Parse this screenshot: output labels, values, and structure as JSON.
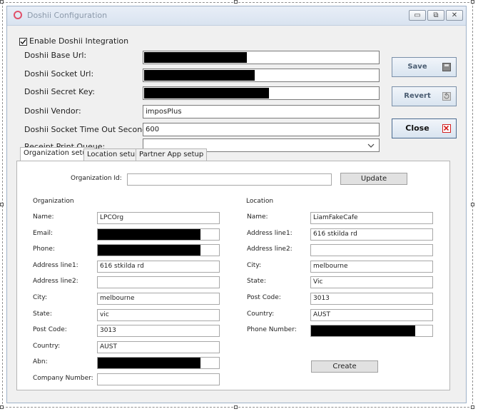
{
  "window": {
    "title": "Doshii Configuration",
    "min_glyph": "▭",
    "max_glyph": "⧉",
    "close_glyph": "✕"
  },
  "enable": {
    "label": "Enable Doshii Integration",
    "checked": true
  },
  "fields": {
    "base_url": {
      "label": "Doshii Base Url:",
      "value": ""
    },
    "socket_url": {
      "label": "Doshii Socket Url:",
      "value": ""
    },
    "secret_key": {
      "label": "Doshii Secret Key:",
      "value": ""
    },
    "vendor": {
      "label": "Doshii Vendor:",
      "value": "imposPlus"
    },
    "timeout": {
      "label": "Doshii Socket Time Out Seconds:",
      "value": "600"
    },
    "print_queue": {
      "label": "Receipt Print Queue:",
      "value": ""
    }
  },
  "buttons": {
    "save": "Save",
    "revert": "Revert",
    "close": "Close"
  },
  "tabs": [
    "Organization setup",
    "Location setup",
    "Partner App setup"
  ],
  "org_id": {
    "label": "Organization Id:",
    "value": "",
    "update": "Update"
  },
  "organization": {
    "heading": "Organization",
    "rows": [
      {
        "label": "Name:",
        "value": "LPCOrg"
      },
      {
        "label": "Email:",
        "value": ""
      },
      {
        "label": "Phone:",
        "value": ""
      },
      {
        "label": "Address line1:",
        "value": "616 stkilda rd"
      },
      {
        "label": "Address line2:",
        "value": ""
      },
      {
        "label": "City:",
        "value": "melbourne"
      },
      {
        "label": "State:",
        "value": "vic"
      },
      {
        "label": "Post Code:",
        "value": "3013"
      },
      {
        "label": "Country:",
        "value": "AUST"
      },
      {
        "label": "Abn:",
        "value": ""
      },
      {
        "label": "Company Number:",
        "value": ""
      }
    ]
  },
  "location": {
    "heading": "Location",
    "rows": [
      {
        "label": "Name:",
        "value": "LiamFakeCafe"
      },
      {
        "label": "Address line1:",
        "value": "616 stkilda rd"
      },
      {
        "label": "Address line2:",
        "value": ""
      },
      {
        "label": "City:",
        "value": "melbourne"
      },
      {
        "label": "State:",
        "value": "Vic"
      },
      {
        "label": "Post Code:",
        "value": "3013"
      },
      {
        "label": "Country:",
        "value": "AUST"
      },
      {
        "label": "Phone Number:",
        "value": ""
      }
    ],
    "create": "Create"
  }
}
